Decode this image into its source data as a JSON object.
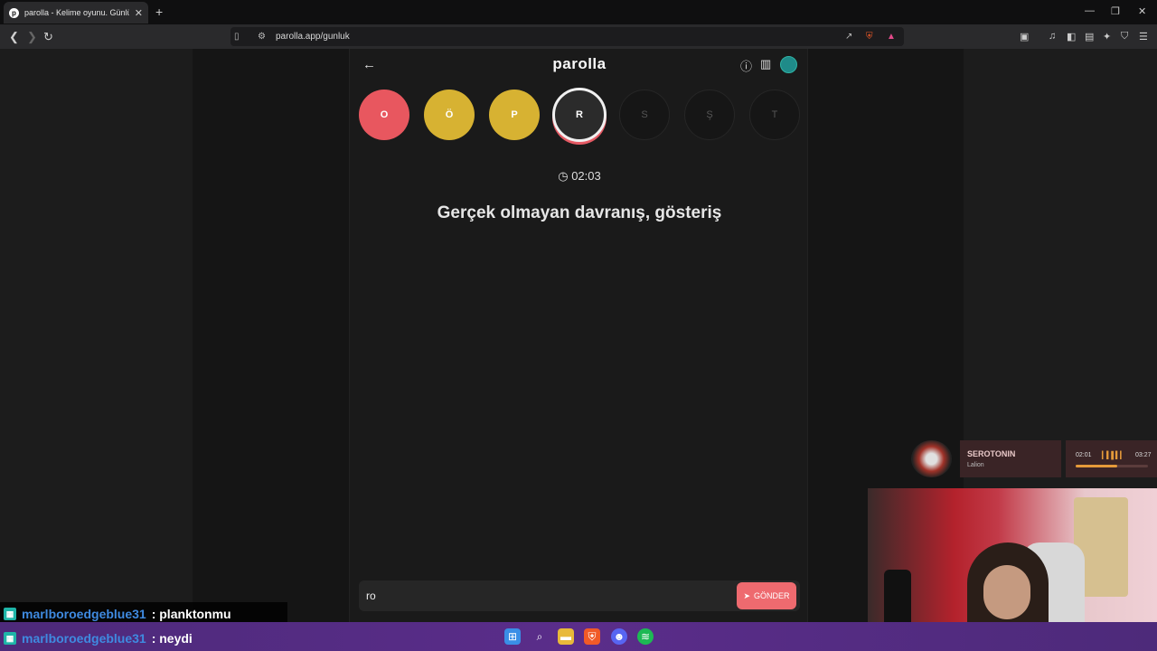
{
  "browser": {
    "tab_title": "parolla - Kelime oyunu. Günlük k",
    "url": "parolla.app/gunluk"
  },
  "app": {
    "brand": "parolla",
    "letters": [
      {
        "letter": "O",
        "state": "wrong",
        "color": "#e8575f"
      },
      {
        "letter": "Ö",
        "state": "passed",
        "color": "#d7b232"
      },
      {
        "letter": "P",
        "state": "passed",
        "color": "#d7b232"
      },
      {
        "letter": "R",
        "state": "active",
        "color": "#2b2b2b"
      },
      {
        "letter": "S",
        "state": "idle",
        "color": "#161616"
      },
      {
        "letter": "Ş",
        "state": "idle",
        "color": "#161616"
      },
      {
        "letter": "T",
        "state": "idle",
        "color": "#161616"
      }
    ],
    "timer": "02:03",
    "clue": "Gerçek olmayan davranış, gösteriş",
    "answer_value": "ro",
    "send_label": "GÖNDER"
  },
  "music": {
    "song": "SEROTONIN",
    "artist": "Lalion",
    "elapsed": "02:01",
    "duration": "03:27",
    "progress": 0.58
  },
  "chat": [
    {
      "user": "marlboroedgeblue31",
      "message": ": planktonmu"
    },
    {
      "user": "marlboroedgeblue31",
      "message": ": neydi"
    }
  ]
}
